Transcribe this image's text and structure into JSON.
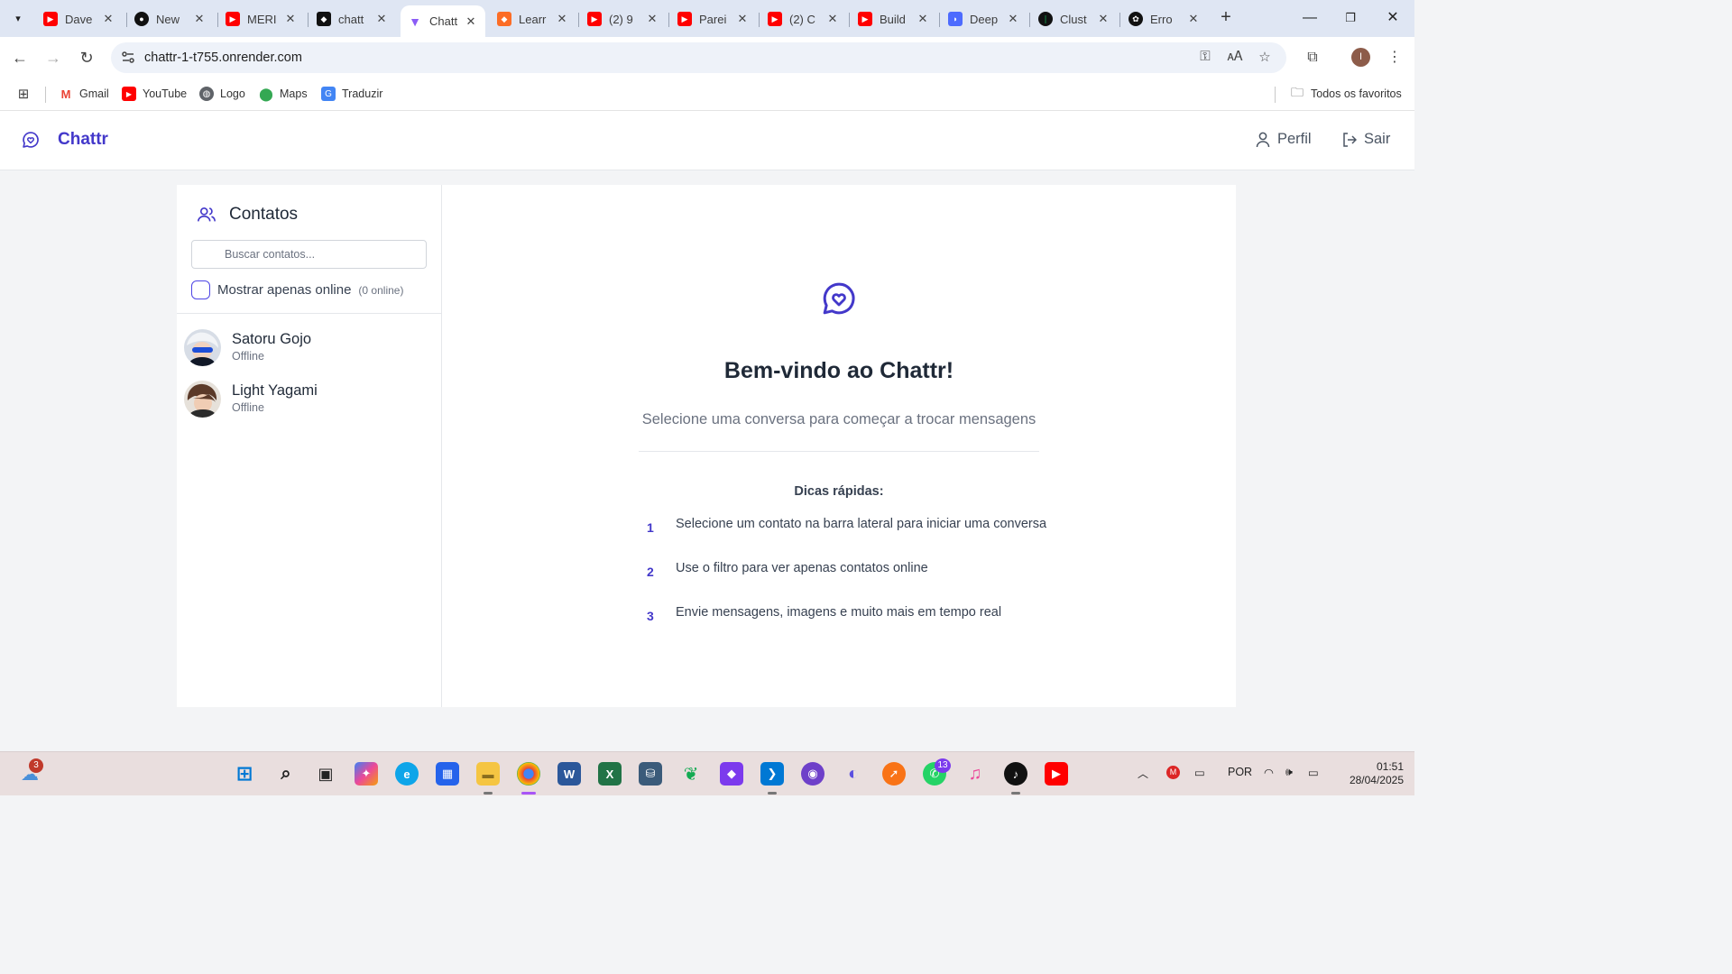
{
  "browser": {
    "tabs": [
      {
        "title": "Dave",
        "favicon": "youtube",
        "color": "#ff0000"
      },
      {
        "title": "New",
        "favicon": "github",
        "color": "#111111"
      },
      {
        "title": "MERI",
        "favicon": "youtube",
        "color": "#ff0000"
      },
      {
        "title": "chatt",
        "favicon": "render",
        "color": "#111111"
      },
      {
        "title": "Chatt",
        "favicon": "vite",
        "color": "#8b5cf6",
        "active": true
      },
      {
        "title": "Learr",
        "favicon": "gitlab",
        "color": "#fc6d26"
      },
      {
        "title": "(2) 9",
        "favicon": "youtube",
        "color": "#ff0000"
      },
      {
        "title": "Parei",
        "favicon": "youtube",
        "color": "#ff0000"
      },
      {
        "title": "(2) C",
        "favicon": "youtube",
        "color": "#ff0000"
      },
      {
        "title": "Build",
        "favicon": "youtube",
        "color": "#ff0000"
      },
      {
        "title": "Deep",
        "favicon": "deepseek",
        "color": "#4d6bfe"
      },
      {
        "title": "Clust",
        "favicon": "mongodb",
        "color": "#13aa52"
      },
      {
        "title": "Erro",
        "favicon": "openai",
        "color": "#111111"
      }
    ],
    "url": "chattr-1-t755.onrender.com",
    "profile_initial": "I",
    "bookmarks": [
      {
        "label": "Gmail",
        "icon": "gmail-icon"
      },
      {
        "label": "YouTube",
        "icon": "youtube-icon"
      },
      {
        "label": "Logo",
        "icon": "globe-icon"
      },
      {
        "label": "Maps",
        "icon": "maps-icon"
      },
      {
        "label": "Traduzir",
        "icon": "translate-icon"
      }
    ],
    "all_bookmarks": "Todos os favoritos"
  },
  "app": {
    "brand": "Chattr",
    "accent": "#4338ca",
    "header": {
      "profile": "Perfil",
      "logout": "Sair"
    },
    "sidebar": {
      "title": "Contatos",
      "search_placeholder": "Buscar contatos...",
      "filter_label": "Mostrar apenas online",
      "online_count": "(0 online)",
      "contacts": [
        {
          "name": "Satoru Gojo",
          "status": "Offline"
        },
        {
          "name": "Light Yagami",
          "status": "Offline"
        }
      ]
    },
    "welcome": {
      "title": "Bem-vindo ao Chattr!",
      "subtitle": "Selecione uma conversa para começar a trocar mensagens",
      "tips_title": "Dicas rápidas:",
      "tips": [
        {
          "n": "1",
          "text": "Selecione um contato na barra lateral para iniciar uma conversa"
        },
        {
          "n": "2",
          "text": "Use o filtro para ver apenas contatos online"
        },
        {
          "n": "3",
          "text": "Envie mensagens, imagens e muito mais em tempo real"
        }
      ]
    }
  },
  "taskbar": {
    "weather_badge": "3",
    "whatsapp_badge": "13",
    "language": "POR",
    "time": "01:51",
    "date": "28/04/2025"
  }
}
